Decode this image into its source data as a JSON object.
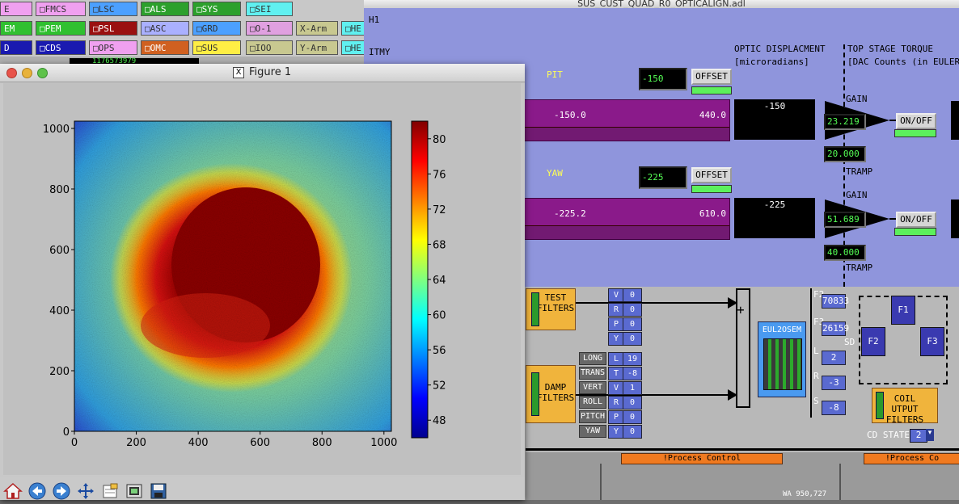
{
  "launcher": {
    "rows": [
      [
        {
          "label": "E",
          "color": "#f0a0f0"
        },
        {
          "label": "□FMCS",
          "color": "#f0a0f0"
        },
        {
          "label": "□LSC",
          "color": "#4ca0ff"
        },
        {
          "label": "□ALS",
          "color": "#2ca02c"
        },
        {
          "label": "□SYS",
          "color": "#2ca02c"
        },
        {
          "label": "□SEI",
          "color": "#60f0f0"
        }
      ],
      [
        {
          "label": "EM",
          "color": "#30c030"
        },
        {
          "label": "□PEM",
          "color": "#30c030"
        },
        {
          "label": "□PSL",
          "color": "#9a1010"
        },
        {
          "label": "□ASC",
          "color": "#aab0ff"
        },
        {
          "label": "□GRD",
          "color": "#4ca0ff"
        },
        {
          "label": "□O-1",
          "color": "#e0a0e0"
        },
        {
          "label": "X-Arm",
          "color": "#c8c890"
        },
        {
          "label": "□HE",
          "color": "#60f0f0"
        }
      ],
      [
        {
          "label": "D",
          "color": "#1a1ab0"
        },
        {
          "label": "□CDS",
          "color": "#1a1ab0"
        },
        {
          "label": "□OPS",
          "color": "#f0a0f0"
        },
        {
          "label": "□OMC",
          "color": "#d06020"
        },
        {
          "label": "□SUS",
          "color": "#ffee44"
        },
        {
          "label": "□IOO",
          "color": "#c8c890"
        },
        {
          "label": "Y-Arm",
          "color": "#c8c890"
        },
        {
          "label": "□HE",
          "color": "#60f0f0"
        }
      ]
    ],
    "gps_value": "1176573979"
  },
  "medm": {
    "title": "SUS_CUST_QUAD_R0_OPTICALIGN.adl",
    "site": "H1",
    "optic": "ITMY",
    "pit_label": "PIT",
    "yaw_label": "YAW",
    "pit_offset": "-150",
    "yaw_offset": "-225",
    "offset_button": "OFFSET",
    "pit_bar_value": "-150.0",
    "pit_bar_max": "440.0",
    "yaw_bar_value": "-225.2",
    "yaw_bar_max": "610.0",
    "pit_display": "-150",
    "yaw_display": "-225",
    "optic_disp_title": "OPTIC DISPLACMENT",
    "optic_disp_units": "[microradians]",
    "torque_title": "TOP STAGE TORQUE",
    "torque_units": "[DAC Counts (in EULER B",
    "gain_label": "GAIN",
    "tramp_label": "TRAMP",
    "pit_gain": "23.219",
    "pit_tramp": "20.000",
    "yaw_gain": "51.689",
    "yaw_tramp": "40.000",
    "onoff_label": "ON/OFF",
    "test_filters": [
      "TEST",
      "FILTERS"
    ],
    "damp_filters": [
      "DAMP",
      "FILTERS"
    ],
    "test_rows": [
      {
        "k": "V",
        "v": "0"
      },
      {
        "k": "R",
        "v": "0"
      },
      {
        "k": "P",
        "v": "0"
      },
      {
        "k": "Y",
        "v": "0"
      }
    ],
    "damp_rows": [
      {
        "btn": "LONG",
        "k": "L",
        "v": "19"
      },
      {
        "btn": "TRANS",
        "k": "T",
        "v": "-8"
      },
      {
        "btn": "VERT",
        "k": "V",
        "v": "1"
      },
      {
        "btn": "ROLL",
        "k": "R",
        "v": "0"
      },
      {
        "btn": "PITCH",
        "k": "P",
        "v": "0"
      },
      {
        "btn": "YAW",
        "k": "Y",
        "v": "0"
      }
    ],
    "eul2osem": "EUL2OSEM",
    "osem_rows": [
      {
        "k": "F2",
        "v": "70833"
      },
      {
        "k": "F3",
        "v": "26159"
      },
      {
        "k": "L",
        "v": "2"
      },
      {
        "k": "R",
        "v": "-3"
      },
      {
        "k": "S",
        "v": "-8"
      }
    ],
    "coil_labels": {
      "sd": "SD",
      "f1": "F1",
      "f2": "F2",
      "f3": "F3"
    },
    "coil_output": [
      "COIL",
      "UTPUT FILTERS"
    ],
    "cd_state_label": "CD STATE",
    "cd_state_value": "2",
    "process_control": "!Process Control",
    "process_control_2": "!Process Co",
    "wa_readout": "WA 950,727"
  },
  "figure": {
    "title": "Figure 1",
    "x_ticks": [
      "0",
      "200",
      "400",
      "600",
      "800",
      "1000"
    ],
    "y_ticks": [
      "1000",
      "800",
      "600",
      "400",
      "200",
      "0"
    ],
    "colorbar_ticks": [
      "80",
      "76",
      "72",
      "68",
      "64",
      "60",
      "56",
      "52",
      "48"
    ]
  },
  "chart_data": {
    "type": "heatmap",
    "title": "",
    "xlabel": "",
    "ylabel": "",
    "xlim": [
      0,
      1024
    ],
    "ylim": [
      0,
      1024
    ],
    "colormap": "jet",
    "colorbar_range": [
      46,
      82
    ],
    "description_values": {
      "background_level": 62,
      "spot_center": [
        540,
        560
      ],
      "spot_level": 82
    }
  },
  "toolbar": [
    "home-icon",
    "back-icon",
    "forward-icon",
    "pan-icon",
    "subplots-icon",
    "configure-icon",
    "save-icon"
  ]
}
